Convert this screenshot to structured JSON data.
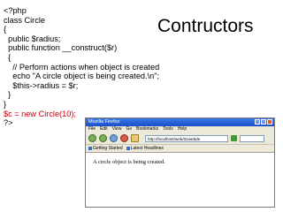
{
  "slide": {
    "title": "Contructors",
    "code_lines": [
      "<?php",
      "class Circle",
      "{",
      "  public $radius;",
      "  public function __construct($r)",
      "  {",
      "    // Perform actions when object is created",
      "    echo \"A circle object is being created.\\n\";",
      "    $this->radius = $r;",
      "  }",
      "}",
      "$c = new Circle(10);",
      "?>"
    ],
    "highlight_color": "#c0000c"
  },
  "browser": {
    "window_title": "Mozilla Firefox",
    "menu": [
      "File",
      "Edit",
      "View",
      "Go",
      "Bookmarks",
      "Tools",
      "Help"
    ],
    "address": "http://localhost/web/01webde",
    "bookmarks": [
      "Getting Started",
      "Latest Headlines"
    ],
    "page_text": "A circle object is being created."
  }
}
